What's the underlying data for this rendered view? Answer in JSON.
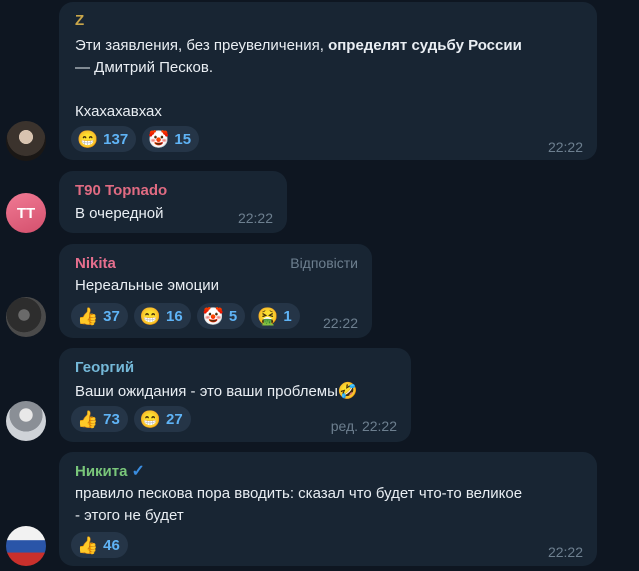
{
  "messages": [
    {
      "author": "Z",
      "line1_prefix": "Эти заявления, без преувеличения, ",
      "line1_bold": "определят судьбу России",
      "line2": "—  Дмитрий Песков.",
      "line3": "Кхахахавхах",
      "reactions": [
        {
          "emoji": "😁",
          "count": "137"
        },
        {
          "emoji": "🤡",
          "count": "15"
        }
      ],
      "time": "22:22"
    },
    {
      "author": "T90 Topnado",
      "avatar_initials": "TT",
      "text": "В очередной",
      "time": "22:22"
    },
    {
      "author": "Nikita",
      "reply_label": "Відповісти",
      "text": "Нереальные эмоции",
      "reactions": [
        {
          "emoji": "👍",
          "count": "37"
        },
        {
          "emoji": "😁",
          "count": "16"
        },
        {
          "emoji": "🤡",
          "count": "5"
        },
        {
          "emoji": "🤮",
          "count": "1"
        }
      ],
      "time": "22:22"
    },
    {
      "author": "Георгий",
      "text": "Ваши ожидания - это ваши проблемы",
      "text_emoji": "🤣",
      "reactions": [
        {
          "emoji": "👍",
          "count": "73"
        },
        {
          "emoji": "😁",
          "count": "27"
        }
      ],
      "time": "ред. 22:22"
    },
    {
      "author": "Никита",
      "author_badge": "✓",
      "line1": "правило пескова пора вводить: сказал что будет что-то великое",
      "line2": "- этого не будет",
      "reactions": [
        {
          "emoji": "👍",
          "count": "46"
        }
      ],
      "time": "22:22"
    }
  ],
  "colors": {
    "background": "#0e1621",
    "bubble": "#182533",
    "name_z": "#c9a64a",
    "name_t90": "#e06b82",
    "name_nikita": "#e66f8e",
    "name_georgiy": "#74b8d8",
    "name_nikita2": "#79c67a",
    "reaction_count": "#5fb3f5",
    "timestamp": "#6d7f8f"
  }
}
